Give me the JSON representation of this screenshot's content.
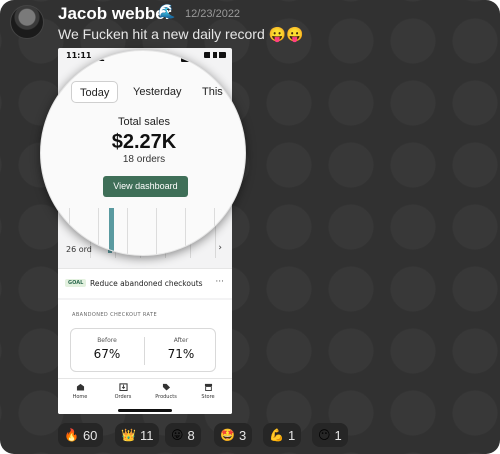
{
  "post": {
    "author": "Jacob webber",
    "author_badge": "🌊",
    "date": "12/23/2022",
    "message": "We Fucken hit a new daily record 😛😛"
  },
  "phone": {
    "status_time": "11:11",
    "tabs": [
      "Today",
      "Yesterday",
      "This w"
    ],
    "sales_label": "Total sales",
    "sales_value": "$2.27K",
    "orders": "18 orders",
    "view_dashboard": "View dashboard",
    "orders_row": "26 ord",
    "goal_badge": "GOAL",
    "goal_text": "Reduce abandoned checkouts",
    "abandoned_label": "ABANDONED CHECKOUT RATE",
    "before_label": "Before",
    "before_value": "67%",
    "after_label": "After",
    "after_value": "71%",
    "nav": [
      {
        "label": "Home",
        "icon": "home-icon"
      },
      {
        "label": "Orders",
        "icon": "orders-icon"
      },
      {
        "label": "Products",
        "icon": "tag-icon"
      },
      {
        "label": "Store",
        "icon": "store-icon"
      }
    ],
    "accent_color": "#3f6f58"
  },
  "reactions": [
    {
      "emoji": "🔥",
      "count": "60"
    },
    {
      "emoji": "👑",
      "count": "11"
    },
    {
      "emoji": "😛",
      "count": "8"
    },
    {
      "emoji": "🤩",
      "count": "3"
    },
    {
      "emoji": "💪",
      "count": "1"
    },
    {
      "emoji": "😶",
      "count": "1"
    }
  ]
}
